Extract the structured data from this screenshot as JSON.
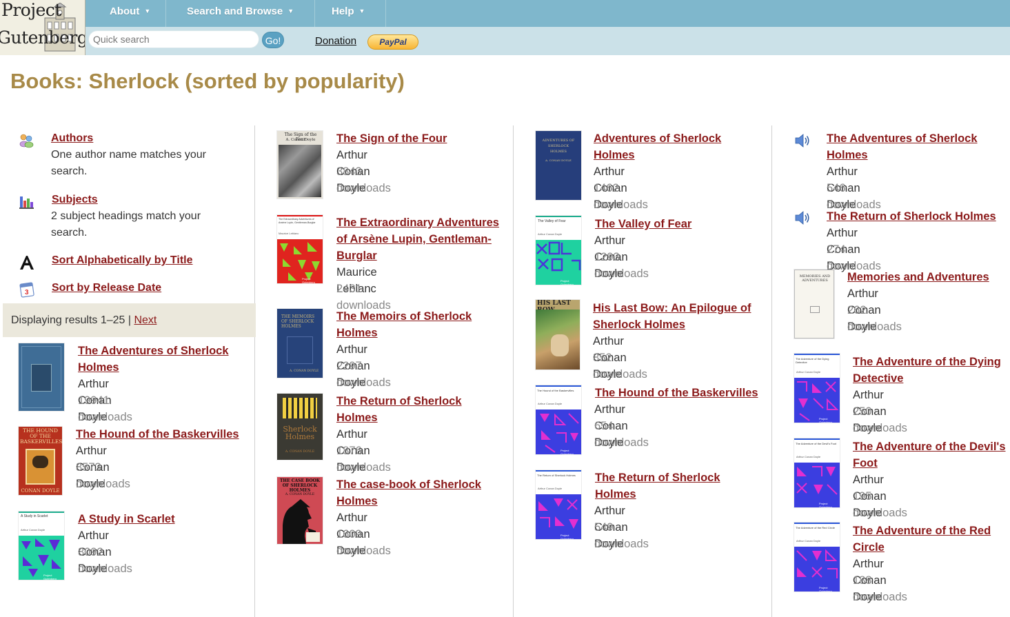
{
  "header": {
    "logo_line1": "Project",
    "logo_line2": "Gutenberg",
    "nav": [
      {
        "label": "About"
      },
      {
        "label": "Search and Browse"
      },
      {
        "label": "Help"
      }
    ],
    "search_placeholder": "Quick search",
    "go_label": "Go!",
    "donation_label": "Donation",
    "paypal_label": "PayPal"
  },
  "page_title": "Books: Sherlock (sorted by popularity)",
  "sidebar": {
    "authors_label": "Authors",
    "authors_desc": "One author name matches your search.",
    "subjects_label": "Subjects",
    "subjects_desc": "2 subject headings match your search.",
    "sort_title_label": "Sort Alphabetically by Title",
    "sort_date_label": "Sort by Release Date",
    "displaying": "Displaying results 1–25 | ",
    "next_label": "Next"
  },
  "books": [
    {
      "title": "The Adventures of Sherlock Holmes",
      "author": "Arthur Conan Doyle",
      "downloads": "19941 downloads",
      "cover": "adventures-blue"
    },
    {
      "title": "The Hound of the Baskervilles",
      "author": "Arthur Conan Doyle",
      "downloads": "8573 downloads",
      "cover": "hound-red"
    },
    {
      "title": "A Study in Scarlet",
      "author": "Arthur Conan Doyle",
      "downloads": "8092 downloads",
      "cover": "generated-teal",
      "cover_text": "A Study in Scarlet"
    },
    {
      "title": "The Sign of the Four",
      "author": "Arthur Conan Doyle",
      "downloads": "3843 downloads",
      "cover": "sign-four",
      "cover_text": "The Sign of the Four / A. Conan Doyle"
    },
    {
      "title": "The Extraordinary Adventures of Arsène Lupin, Gentleman-Burglar",
      "author": "Maurice Leblanc",
      "downloads": "2431 downloads",
      "cover": "generated-red",
      "cover_text": "The Extraordinary Adventures of Arsène Lupin, Gentleman-Burglar"
    },
    {
      "title": "The Memoirs of Sherlock Holmes",
      "author": "Arthur Conan Doyle",
      "downloads": "2297 downloads",
      "cover": "memoirs-blue"
    },
    {
      "title": "The Return of Sherlock Holmes",
      "author": "Arthur Conan Doyle",
      "downloads": "1876 downloads",
      "cover": "return-dark"
    },
    {
      "title": "The case-book of Sherlock Holmes",
      "author": "Arthur Conan Doyle",
      "downloads": "1609 downloads",
      "cover": "casebook"
    },
    {
      "title": "Adventures of Sherlock Holmes",
      "author": "Arthur Conan Doyle",
      "downloads": "1462 downloads",
      "cover": "adventures-navy"
    },
    {
      "title": "The Valley of Fear",
      "author": "Arthur Conan Doyle",
      "downloads": "1293 downloads",
      "cover": "generated-green",
      "cover_text": "The Valley of Fear"
    },
    {
      "title": "His Last Bow: An Epilogue of Sherlock Holmes",
      "author": "Arthur Conan Doyle",
      "downloads": "852 downloads",
      "cover": "lastbow"
    },
    {
      "title": "The Hound of the Baskervilles",
      "author": "Arthur Conan Doyle",
      "downloads": "654 downloads",
      "cover": "generated-blue",
      "cover_text": "The Hound of the Baskervilles"
    },
    {
      "title": "The Return of Sherlock Holmes",
      "author": "Arthur Conan Doyle",
      "downloads": "549 downloads",
      "cover": "generated-blue",
      "cover_text": "The Return of Sherlock Holmes"
    },
    {
      "title": "The Adventures of Sherlock Holmes",
      "author": "Arthur Conan Doyle",
      "downloads": "546 downloads",
      "cover": "audio"
    },
    {
      "title": "The Return of Sherlock Holmes",
      "author": "Arthur Conan Doyle",
      "downloads": "274 downloads",
      "cover": "audio"
    },
    {
      "title": "Memories and Adventures",
      "author": "Arthur Conan Doyle",
      "downloads": "262 downloads",
      "cover": "memories"
    },
    {
      "title": "The Adventure of the Dying Detective",
      "author": "Arthur Conan Doyle",
      "downloads": "250 downloads",
      "cover": "generated-blue",
      "cover_text": "The Adventure of the Dying Detective"
    },
    {
      "title": "The Adventure of the Devil's Foot",
      "author": "Arthur Conan Doyle",
      "downloads": "195 downloads",
      "cover": "generated-blue",
      "cover_text": "The Adventure of the Devil's Foot"
    },
    {
      "title": "The Adventure of the Red Circle",
      "author": "Arthur Conan Doyle",
      "downloads": "188 downloads",
      "cover": "generated-blue",
      "cover_text": "The Adventure of the Red Circle"
    }
  ],
  "covers": {
    "generated_author": "Arthur Conan Doyle",
    "generated_footer": "Project Gutenberg",
    "sign_four_title": "The Sign of the Four",
    "sign_four_author": "A. Conan Doyle",
    "lupin_author": "Maurice Leblanc",
    "lastbow_title": "HIS LAST BOW",
    "hound_red_title": "THE HOUND OF THE BASKERVILLES",
    "hound_red_author": "CONAN DOYLE",
    "casebook_title": "THE CASE BOOK OF SHERLOCK HOLMES",
    "casebook_author": "A. CONAN DOYLE",
    "return_dark_title": "Sherlock Holmes",
    "return_dark_author": "A. CONAN DOYLE",
    "memories_title": "MEMORIES AND ADVENTURES",
    "adventures_navy_title": "ADVENTURES OF SHERLOCK HOLMES",
    "adventures_navy_author": "A. CONAN DOYLE",
    "memoirs_title": "THE MEMOIRS OF SHERLOCK HOLMES",
    "memoirs_author": "A. CONAN DOYLE"
  },
  "colors": {
    "topbar": "#7fb7cc",
    "subbar": "#cbe1e8",
    "title": "#a88a48",
    "link": "#8b1a1a"
  }
}
